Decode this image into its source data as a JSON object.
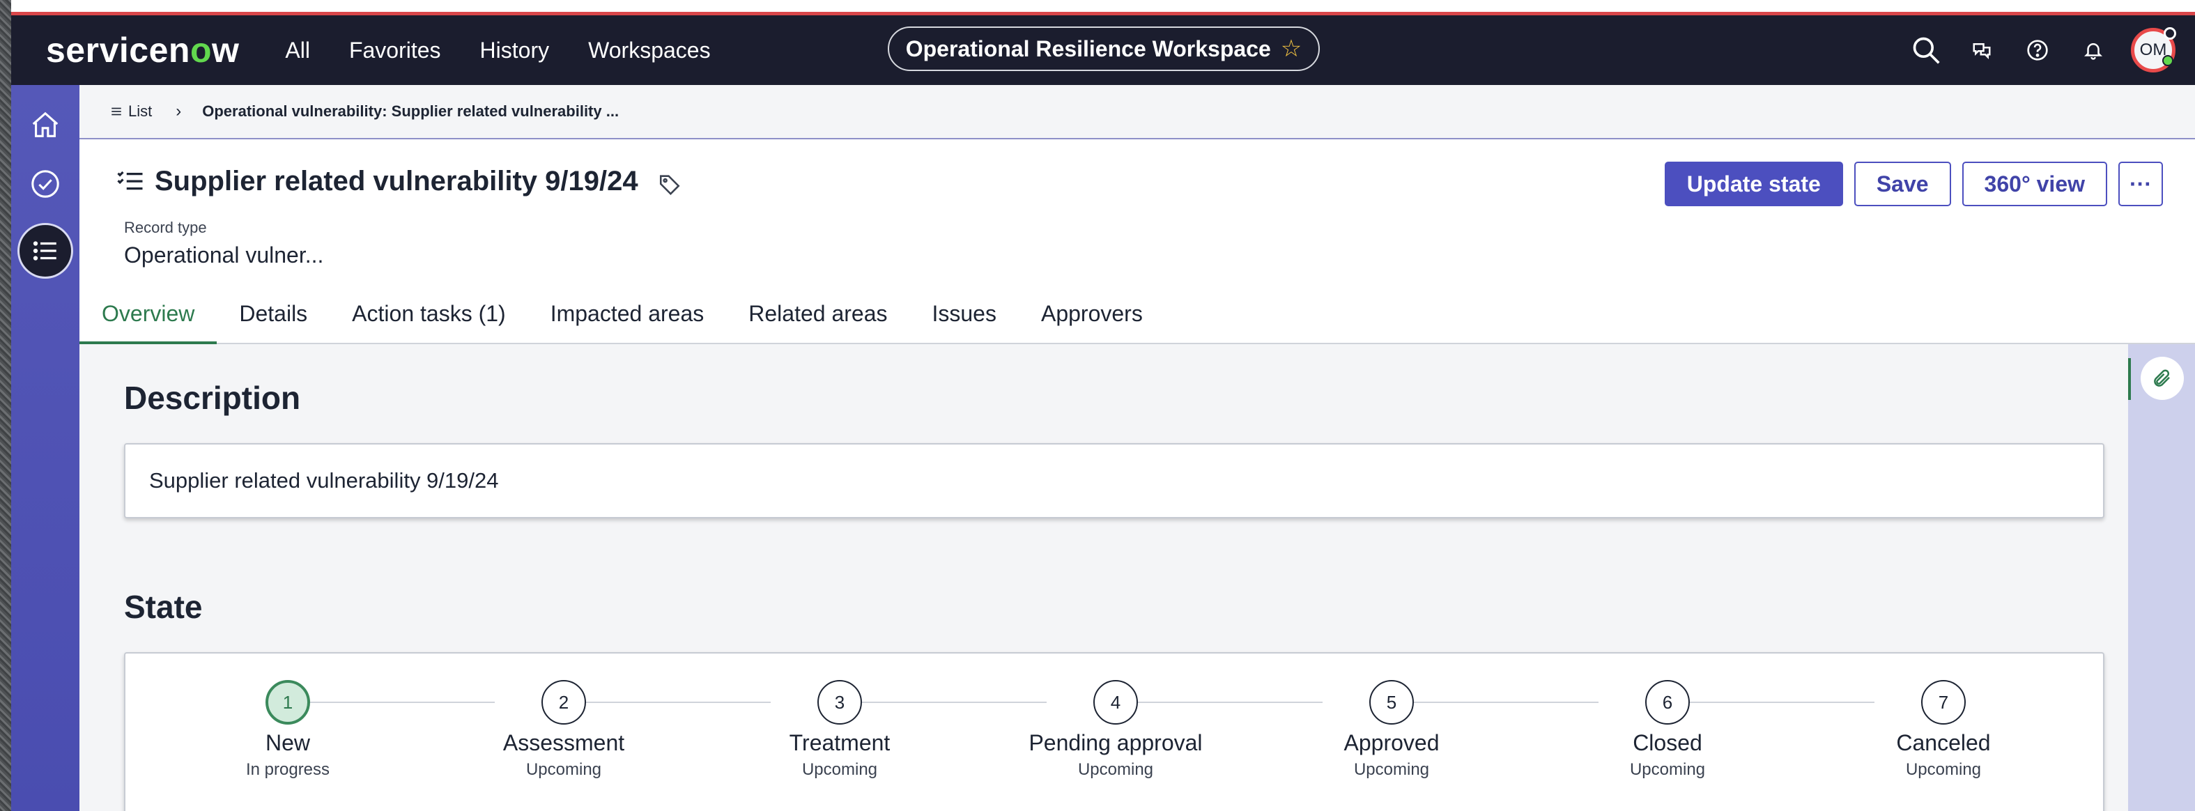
{
  "header": {
    "logo_text_a": "servicen",
    "logo_text_o": "o",
    "logo_text_b": "w",
    "nav": [
      "All",
      "Favorites",
      "History",
      "Workspaces"
    ],
    "workspace_title": "Operational Resilience Workspace",
    "avatar_initials": "OM"
  },
  "breadcrumb": {
    "list_label": "List",
    "current": "Operational vulnerability: Supplier related vulnerability ..."
  },
  "record": {
    "title": "Supplier related vulnerability 9/19/24",
    "type_label": "Record type",
    "type_value": "Operational vulner...",
    "actions": {
      "update_state": "Update state",
      "save": "Save",
      "view360": "360° view",
      "more": "···"
    }
  },
  "tabs": [
    "Overview",
    "Details",
    "Action tasks (1)",
    "Impacted areas",
    "Related areas",
    "Issues",
    "Approvers"
  ],
  "description": {
    "heading": "Description",
    "text": "Supplier related vulnerability 9/19/24"
  },
  "state": {
    "heading": "State",
    "steps": [
      {
        "num": "1",
        "name": "New",
        "status": "In progress"
      },
      {
        "num": "2",
        "name": "Assessment",
        "status": "Upcoming"
      },
      {
        "num": "3",
        "name": "Treatment",
        "status": "Upcoming"
      },
      {
        "num": "4",
        "name": "Pending approval",
        "status": "Upcoming"
      },
      {
        "num": "5",
        "name": "Approved",
        "status": "Upcoming"
      },
      {
        "num": "6",
        "name": "Closed",
        "status": "Upcoming"
      },
      {
        "num": "7",
        "name": "Canceled",
        "status": "Upcoming"
      }
    ]
  },
  "colors": {
    "header_bg": "#1b1d2e",
    "accent_primary": "#4c4fbf",
    "active_green": "#2d7a4e",
    "logo_green": "#62d84e"
  },
  "icons": {
    "search": "search-icon",
    "chat": "chat-icon",
    "help": "help-icon",
    "bell": "bell-icon",
    "home": "home-icon",
    "check": "check-circle-icon",
    "list": "list-icon",
    "tag": "tag-icon",
    "paperclip": "paperclip-icon"
  }
}
